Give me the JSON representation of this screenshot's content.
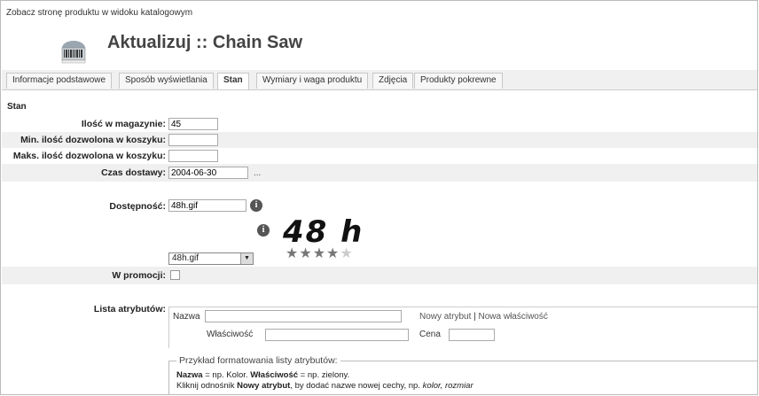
{
  "top_link": "Zobacz stronę produktu w widoku katalogowym",
  "page_title": "Aktualizuj :: Chain Saw",
  "tabs": [
    {
      "label": "Informacje podstawowe"
    },
    {
      "label": "Sposób wyświetlania"
    },
    {
      "label": "Stan"
    },
    {
      "label": "Wymiary i waga produktu"
    },
    {
      "label": "Zdjęcia"
    },
    {
      "label": "Produkty pokrewne"
    }
  ],
  "active_tab": "Stan",
  "section_title": "Stan",
  "fields": {
    "stock": {
      "label": "Ilość w magazynie:",
      "value": "45"
    },
    "min_cart": {
      "label": "Min. ilość dozwolona w koszyku:",
      "value": ""
    },
    "max_cart": {
      "label": "Maks. ilość dozwolona w koszyku:",
      "value": ""
    },
    "delivery": {
      "label": "Czas dostawy:",
      "value": "2004-06-30",
      "picker": "..."
    },
    "availability": {
      "label": "Dostępność:",
      "value": "48h.gif",
      "preview_text": "48 h",
      "stars": 4,
      "select_value": "48h.gif"
    },
    "promo": {
      "label": "W promocji:",
      "checked": false
    },
    "attributes": {
      "label": "Lista atrybutów:",
      "name_label": "Nazwa",
      "name_value": "",
      "new_attr": "Nowy atrybut",
      "sep": " | ",
      "new_prop": "Nowa właściwość",
      "prop_label": "Właściwość",
      "prop_value": "",
      "price_label": "Cena",
      "price_value": ""
    }
  },
  "example": {
    "legend": "Przykład formatowania listy atrybutów:",
    "line1_b1": "Nazwa",
    "line1_t1": " = np. Kolor. ",
    "line1_b2": "Właściwość",
    "line1_t2": " = np. zielony.",
    "line2_t1": "Kliknij odnośnik ",
    "line2_b1": "Nowy atrybut",
    "line2_t2": ", by dodać nazwe nowej cechy, np. ",
    "line2_i1": "kolor, rozmiar"
  },
  "info_icon_glyph": "i",
  "dropdown_arrow": "▼",
  "star_glyph": "★"
}
